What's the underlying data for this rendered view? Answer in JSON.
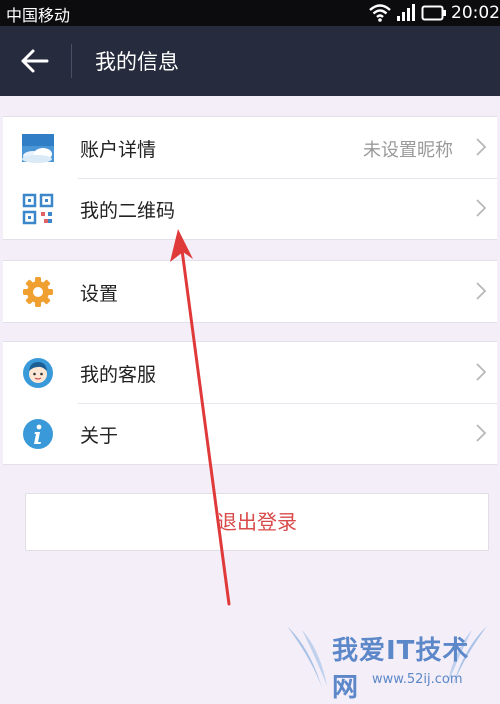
{
  "status_bar": {
    "carrier": "中国移动",
    "time": "20:02",
    "wifi_icon": "wifi-icon",
    "signal_icon": "signal-icon",
    "battery_icon": "battery-icon"
  },
  "app_bar": {
    "back_icon": "arrow-left-icon",
    "title": "我的信息"
  },
  "groups": [
    {
      "items": [
        {
          "icon": "sky-avatar-icon",
          "label": "账户详情",
          "value": "未设置昵称"
        },
        {
          "icon": "qr-code-icon",
          "label": "我的二维码"
        }
      ]
    },
    {
      "items": [
        {
          "icon": "gear-icon",
          "label": "设置"
        }
      ]
    },
    {
      "items": [
        {
          "icon": "customer-service-icon",
          "label": "我的客服"
        },
        {
          "icon": "info-icon",
          "label": "关于"
        }
      ]
    }
  ],
  "logout": {
    "label": "退出登录"
  },
  "watermark": {
    "text": "我爱IT技术网",
    "url": "www.52ij.com"
  },
  "colors": {
    "app_bar": "#262c3e",
    "page_bg": "#f3eef8",
    "logout_text": "#d94a4a",
    "annotation_arrow": "#e0393a"
  }
}
